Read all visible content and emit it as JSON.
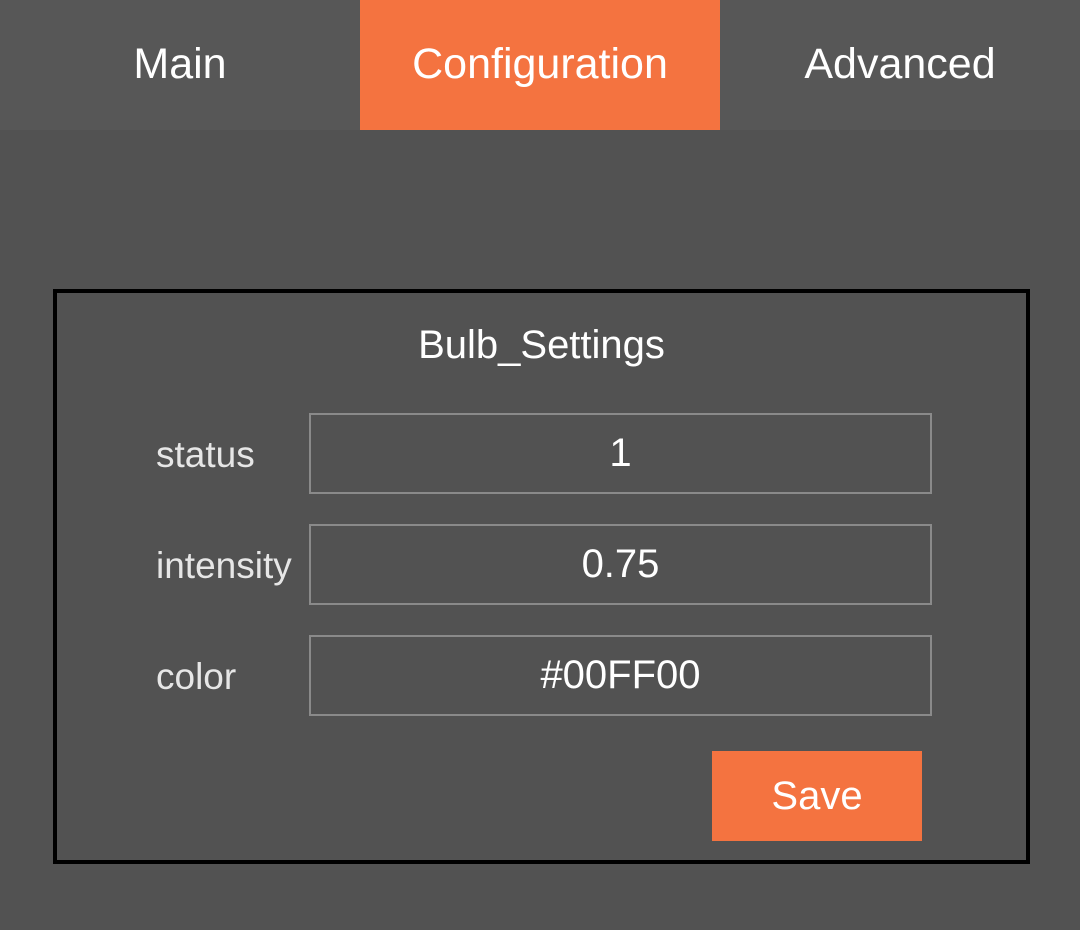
{
  "tabs": [
    {
      "label": "Main",
      "active": false
    },
    {
      "label": "Configuration",
      "active": true
    },
    {
      "label": "Advanced",
      "active": false
    }
  ],
  "panel": {
    "title": "Bulb_Settings",
    "fields": [
      {
        "label": "status",
        "value": "1"
      },
      {
        "label": "intensity",
        "value": "0.75"
      },
      {
        "label": "color",
        "value": "#00FF00"
      }
    ],
    "save_label": "Save"
  },
  "colors": {
    "accent": "#f47340",
    "background": "#525252",
    "tabbar": "#575757"
  }
}
